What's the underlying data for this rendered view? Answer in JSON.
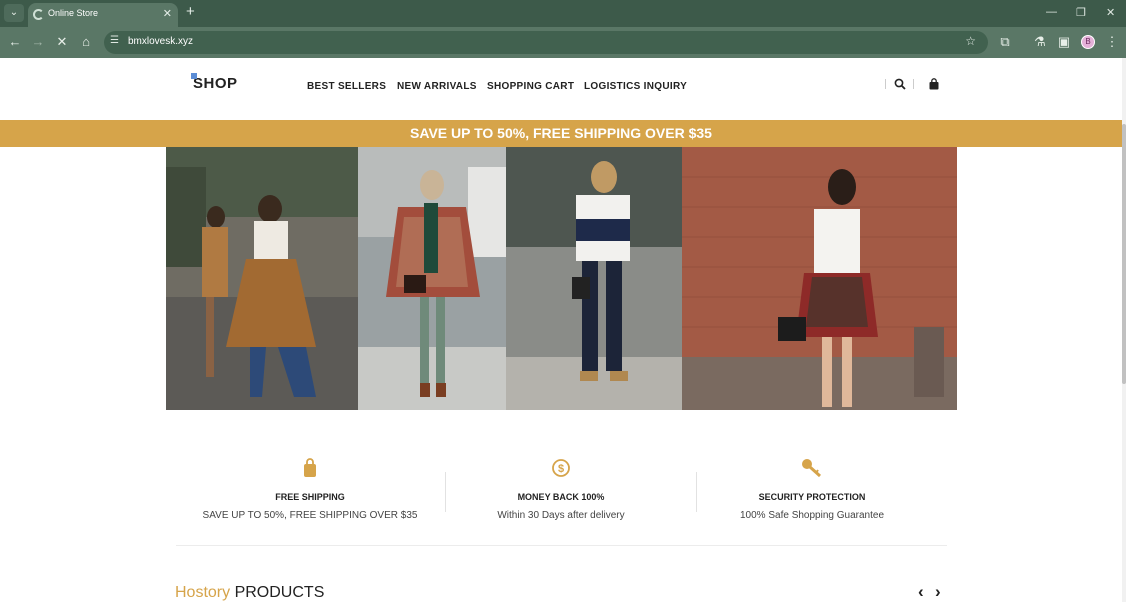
{
  "browser": {
    "tab_title": "Online Store",
    "url": "bmxlovesk.xyz",
    "avatar_initial": "B"
  },
  "site": {
    "logo_text": "SHOP",
    "nav": [
      "BEST SELLERS",
      "NEW ARRIVALS",
      "SHOPPING CART",
      "LOGISTICS INQUIRY"
    ],
    "banner": "SAVE UP TO 50%, FREE SHIPPING OVER $35",
    "brand_color": "#d6a44a"
  },
  "features": [
    {
      "icon": "bag-icon",
      "title": "FREE SHIPPING",
      "text": "SAVE UP TO 50%, FREE SHIPPING OVER $35"
    },
    {
      "icon": "money-back-icon",
      "title": "MONEY BACK 100%",
      "text": "Within 30 Days after delivery"
    },
    {
      "icon": "key-icon",
      "title": "SECURITY PROTECTION",
      "text": "100% Safe Shopping Guarantee"
    }
  ],
  "section": {
    "accent": "Hostory",
    "main": "PRODUCTS"
  }
}
